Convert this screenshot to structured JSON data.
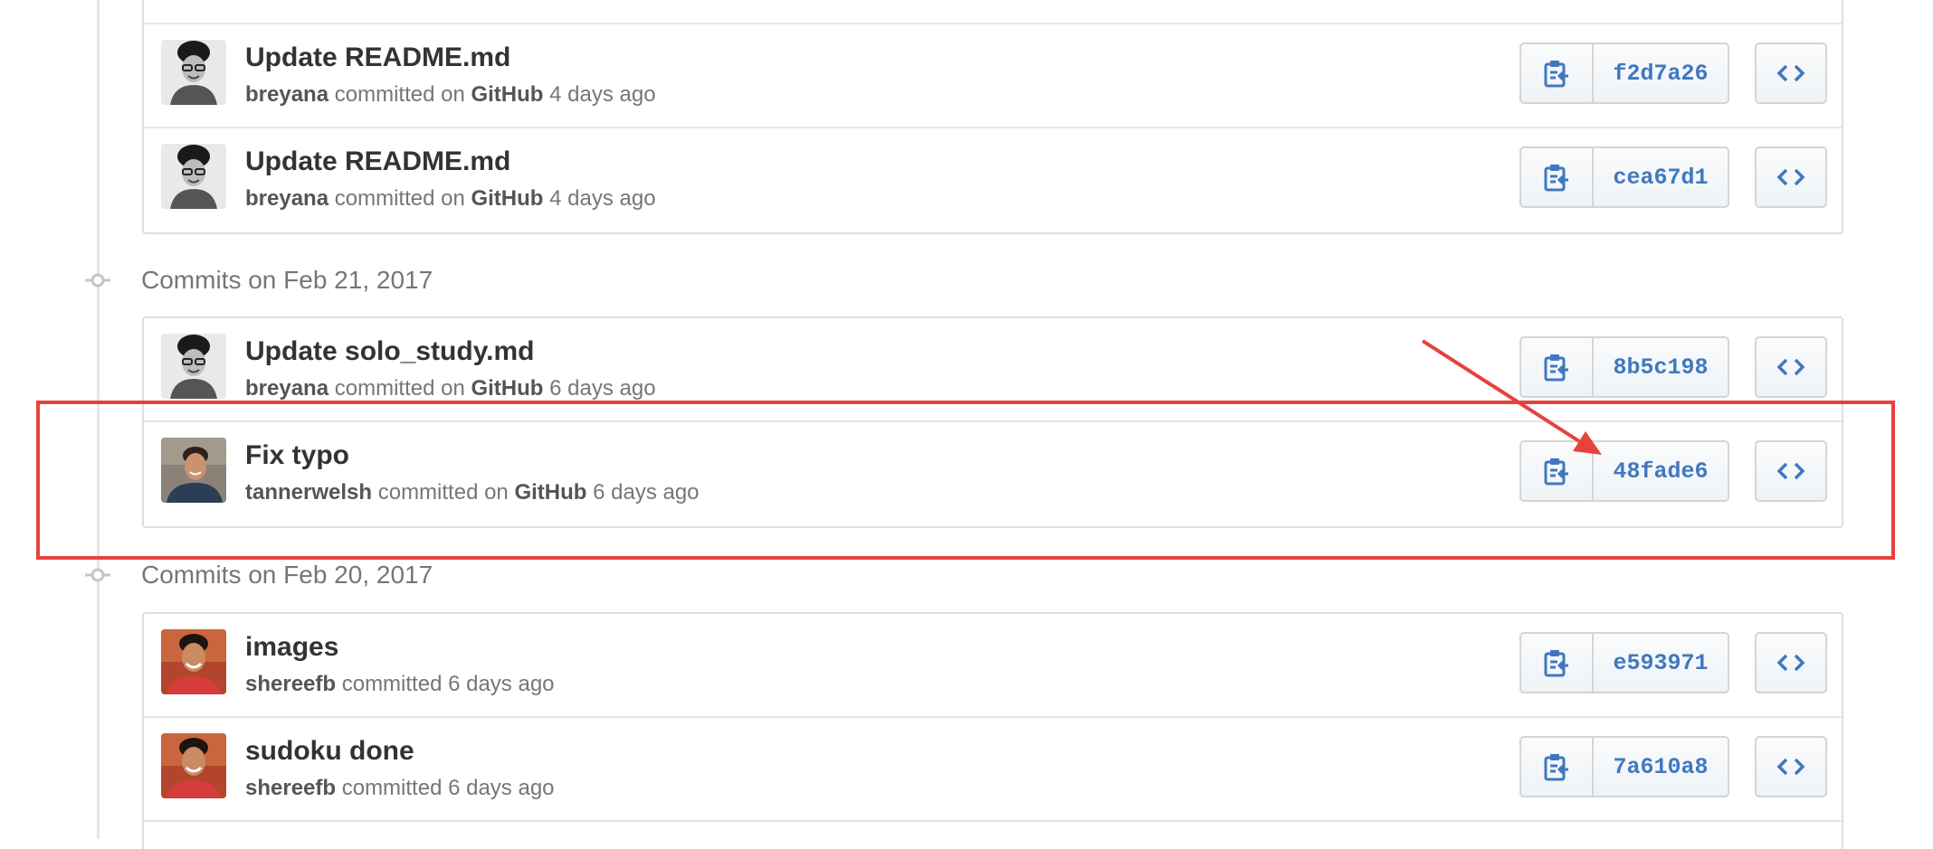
{
  "groups": [
    {
      "date_label": "",
      "commits": [
        {
          "title": "Update README.md",
          "author": "breyana",
          "committed_text": "committed on",
          "via": "GitHub",
          "time": "4 days ago",
          "sha": "f2d7a26",
          "avatar": "breyana-avatar"
        },
        {
          "title": "Update README.md",
          "author": "breyana",
          "committed_text": "committed on",
          "via": "GitHub",
          "time": "4 days ago",
          "sha": "cea67d1",
          "avatar": "breyana-avatar"
        }
      ]
    },
    {
      "date_label": "Commits on Feb 21, 2017",
      "commits": [
        {
          "title": "Update solo_study.md",
          "author": "breyana",
          "committed_text": "committed on",
          "via": "GitHub",
          "time": "6 days ago",
          "sha": "8b5c198",
          "avatar": "breyana-avatar"
        },
        {
          "title": "Fix typo",
          "author": "tannerwelsh",
          "committed_text": "committed on",
          "via": "GitHub",
          "time": "6 days ago",
          "sha": "48fade6",
          "avatar": "tannerwelsh-avatar"
        }
      ]
    },
    {
      "date_label": "Commits on Feb 20, 2017",
      "commits": [
        {
          "title": "images",
          "author": "shereefb",
          "committed_text": "committed",
          "via": "",
          "time": "6 days ago",
          "sha": "e593971",
          "avatar": "shereefb-avatar"
        },
        {
          "title": "sudoku done",
          "author": "shereefb",
          "committed_text": "committed",
          "via": "",
          "time": "6 days ago",
          "sha": "7a610a8",
          "avatar": "shereefb-avatar"
        }
      ]
    }
  ],
  "icons": {
    "copy": "clipboard-icon",
    "browse": "code-icon",
    "timeline_node": "commit-node-icon"
  },
  "annotation": {
    "color": "#e8413c",
    "highlighted_commit_sha": "48fade6"
  },
  "colors": {
    "sha_link": "#4078c0",
    "muted_text": "#767676"
  }
}
